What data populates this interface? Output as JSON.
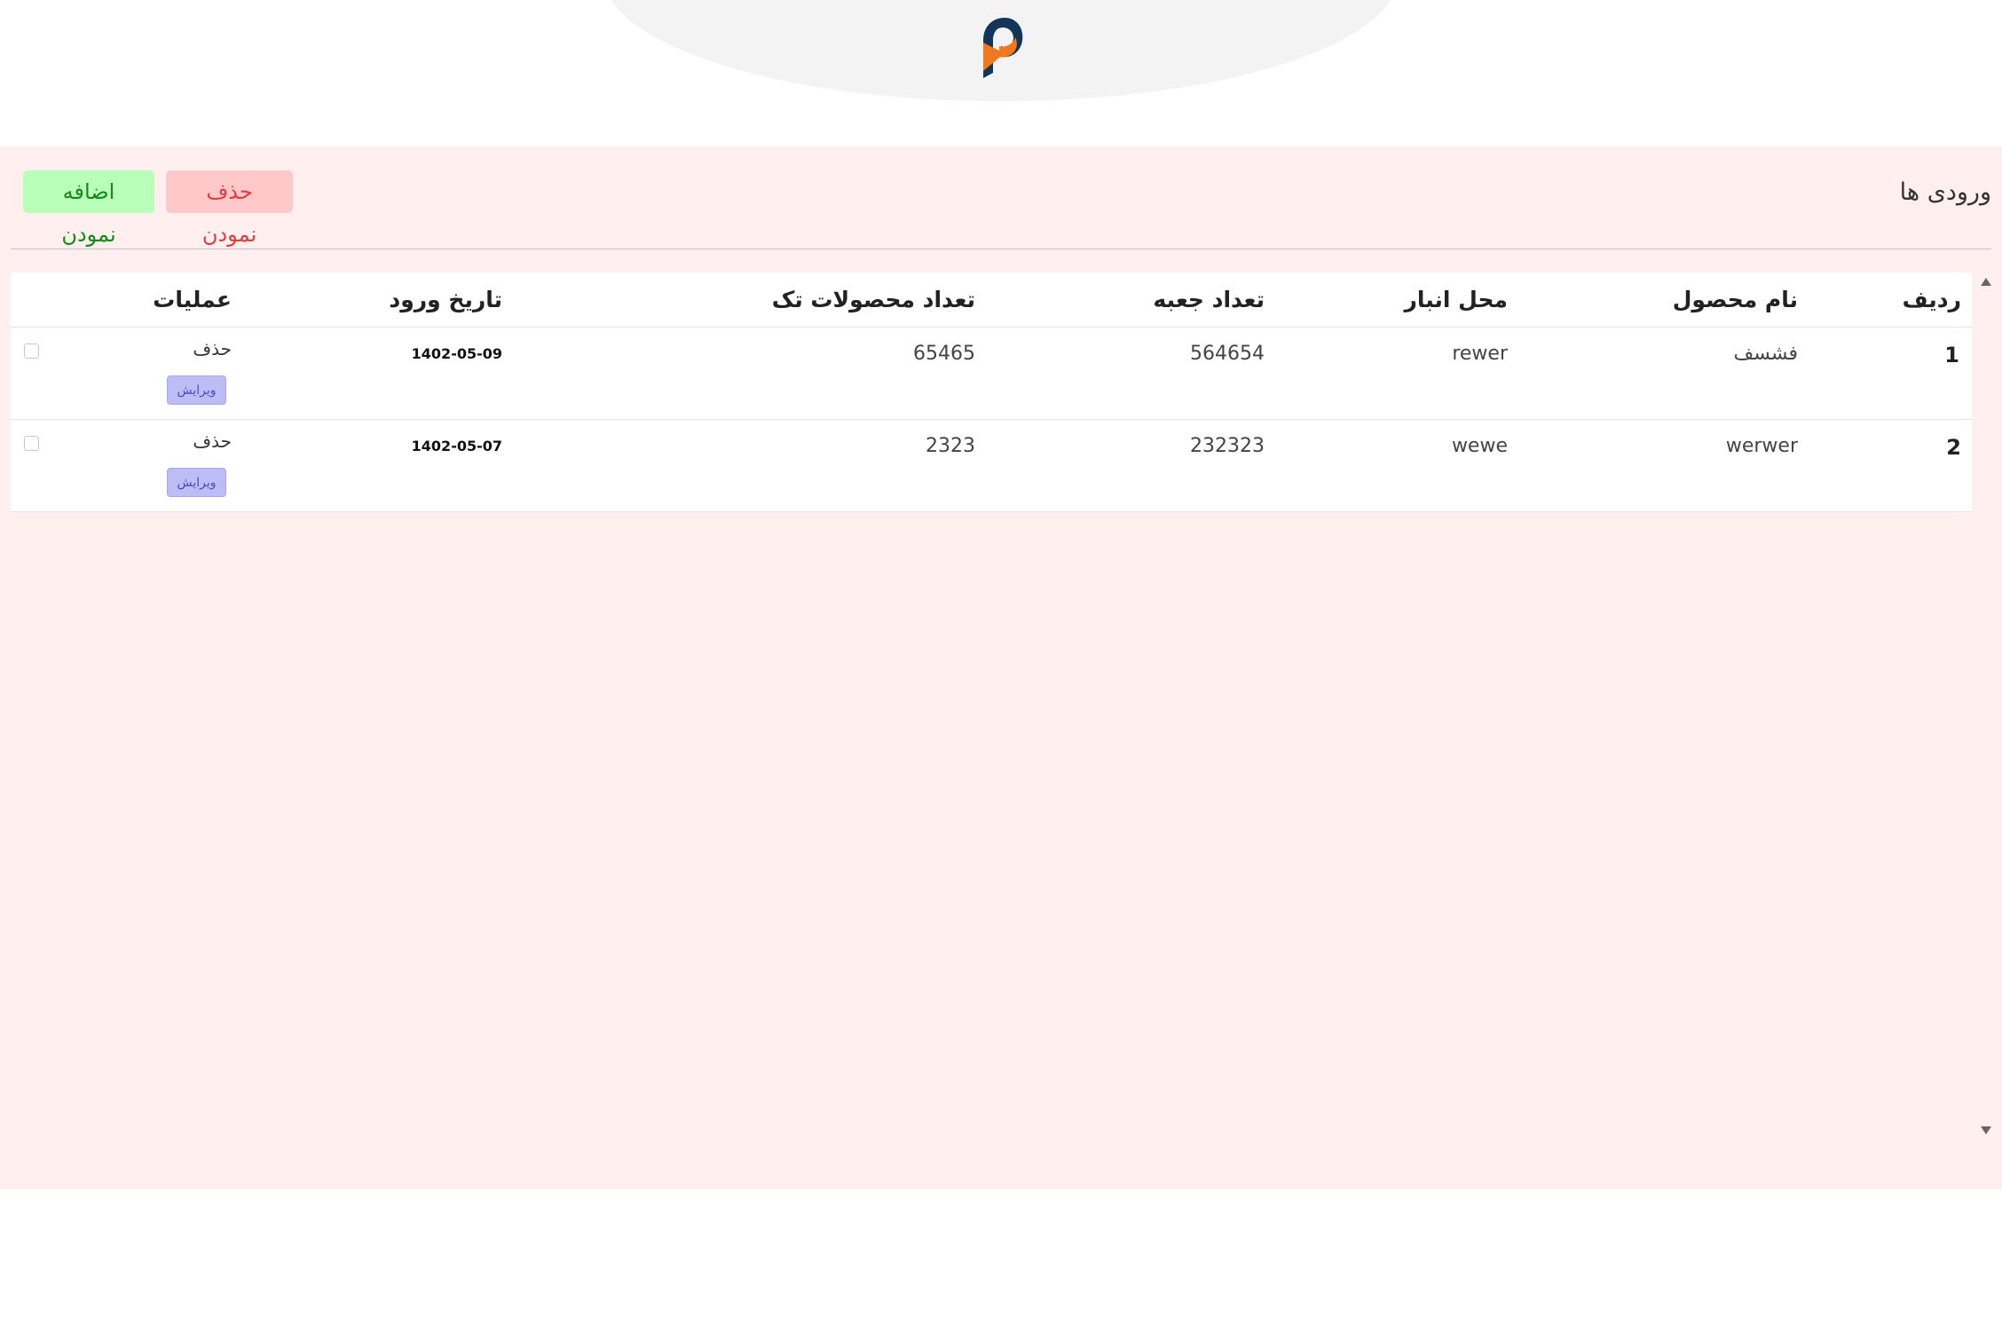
{
  "header": {
    "logo_icon": "brand-p-logo-icon",
    "colors": {
      "logo_navy": "#13355a",
      "logo_orange": "#f07820",
      "ellipse": "#f3f3f3"
    }
  },
  "panel": {
    "title": "ورودی ها",
    "add_button": "اضافه نمودن",
    "delete_button": "حذف نمودن",
    "colors": {
      "background": "#fff0ef",
      "add_bg": "#b9ffb9",
      "add_text": "#138a1b",
      "delete_bg": "#ffc9c9",
      "delete_text": "#e23c3c"
    }
  },
  "table": {
    "columns": [
      "ردیف",
      "نام محصول",
      "محل انبار",
      "تعداد جعبه",
      "تعداد محصولات تک",
      "تاریخ ورود",
      "عملیات"
    ],
    "rows": [
      {
        "index": "1",
        "product": "فشسف",
        "warehouse": "rewer",
        "boxes": "564654",
        "singles": "65465",
        "date": "1402-05-09",
        "delete": "حذف",
        "edit": "ویرایش"
      },
      {
        "index": "2",
        "product": "werwer",
        "warehouse": "wewe",
        "boxes": "232323",
        "singles": "2323",
        "date": "1402-05-07",
        "delete": "حذف",
        "edit": "ویرایش"
      }
    ]
  }
}
